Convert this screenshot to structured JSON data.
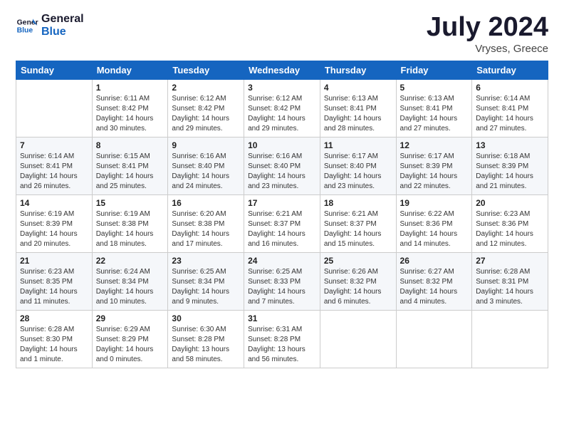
{
  "logo": {
    "line1": "General",
    "line2": "Blue"
  },
  "title": "July 2024",
  "subtitle": "Vryses, Greece",
  "days_of_week": [
    "Sunday",
    "Monday",
    "Tuesday",
    "Wednesday",
    "Thursday",
    "Friday",
    "Saturday"
  ],
  "weeks": [
    [
      {
        "day": "",
        "content": ""
      },
      {
        "day": "1",
        "content": "Sunrise: 6:11 AM\nSunset: 8:42 PM\nDaylight: 14 hours\nand 30 minutes."
      },
      {
        "day": "2",
        "content": "Sunrise: 6:12 AM\nSunset: 8:42 PM\nDaylight: 14 hours\nand 29 minutes."
      },
      {
        "day": "3",
        "content": "Sunrise: 6:12 AM\nSunset: 8:42 PM\nDaylight: 14 hours\nand 29 minutes."
      },
      {
        "day": "4",
        "content": "Sunrise: 6:13 AM\nSunset: 8:41 PM\nDaylight: 14 hours\nand 28 minutes."
      },
      {
        "day": "5",
        "content": "Sunrise: 6:13 AM\nSunset: 8:41 PM\nDaylight: 14 hours\nand 27 minutes."
      },
      {
        "day": "6",
        "content": "Sunrise: 6:14 AM\nSunset: 8:41 PM\nDaylight: 14 hours\nand 27 minutes."
      }
    ],
    [
      {
        "day": "7",
        "content": "Sunrise: 6:14 AM\nSunset: 8:41 PM\nDaylight: 14 hours\nand 26 minutes."
      },
      {
        "day": "8",
        "content": "Sunrise: 6:15 AM\nSunset: 8:41 PM\nDaylight: 14 hours\nand 25 minutes."
      },
      {
        "day": "9",
        "content": "Sunrise: 6:16 AM\nSunset: 8:40 PM\nDaylight: 14 hours\nand 24 minutes."
      },
      {
        "day": "10",
        "content": "Sunrise: 6:16 AM\nSunset: 8:40 PM\nDaylight: 14 hours\nand 23 minutes."
      },
      {
        "day": "11",
        "content": "Sunrise: 6:17 AM\nSunset: 8:40 PM\nDaylight: 14 hours\nand 23 minutes."
      },
      {
        "day": "12",
        "content": "Sunrise: 6:17 AM\nSunset: 8:39 PM\nDaylight: 14 hours\nand 22 minutes."
      },
      {
        "day": "13",
        "content": "Sunrise: 6:18 AM\nSunset: 8:39 PM\nDaylight: 14 hours\nand 21 minutes."
      }
    ],
    [
      {
        "day": "14",
        "content": "Sunrise: 6:19 AM\nSunset: 8:39 PM\nDaylight: 14 hours\nand 20 minutes."
      },
      {
        "day": "15",
        "content": "Sunrise: 6:19 AM\nSunset: 8:38 PM\nDaylight: 14 hours\nand 18 minutes."
      },
      {
        "day": "16",
        "content": "Sunrise: 6:20 AM\nSunset: 8:38 PM\nDaylight: 14 hours\nand 17 minutes."
      },
      {
        "day": "17",
        "content": "Sunrise: 6:21 AM\nSunset: 8:37 PM\nDaylight: 14 hours\nand 16 minutes."
      },
      {
        "day": "18",
        "content": "Sunrise: 6:21 AM\nSunset: 8:37 PM\nDaylight: 14 hours\nand 15 minutes."
      },
      {
        "day": "19",
        "content": "Sunrise: 6:22 AM\nSunset: 8:36 PM\nDaylight: 14 hours\nand 14 minutes."
      },
      {
        "day": "20",
        "content": "Sunrise: 6:23 AM\nSunset: 8:36 PM\nDaylight: 14 hours\nand 12 minutes."
      }
    ],
    [
      {
        "day": "21",
        "content": "Sunrise: 6:23 AM\nSunset: 8:35 PM\nDaylight: 14 hours\nand 11 minutes."
      },
      {
        "day": "22",
        "content": "Sunrise: 6:24 AM\nSunset: 8:34 PM\nDaylight: 14 hours\nand 10 minutes."
      },
      {
        "day": "23",
        "content": "Sunrise: 6:25 AM\nSunset: 8:34 PM\nDaylight: 14 hours\nand 9 minutes."
      },
      {
        "day": "24",
        "content": "Sunrise: 6:25 AM\nSunset: 8:33 PM\nDaylight: 14 hours\nand 7 minutes."
      },
      {
        "day": "25",
        "content": "Sunrise: 6:26 AM\nSunset: 8:32 PM\nDaylight: 14 hours\nand 6 minutes."
      },
      {
        "day": "26",
        "content": "Sunrise: 6:27 AM\nSunset: 8:32 PM\nDaylight: 14 hours\nand 4 minutes."
      },
      {
        "day": "27",
        "content": "Sunrise: 6:28 AM\nSunset: 8:31 PM\nDaylight: 14 hours\nand 3 minutes."
      }
    ],
    [
      {
        "day": "28",
        "content": "Sunrise: 6:28 AM\nSunset: 8:30 PM\nDaylight: 14 hours\nand 1 minute."
      },
      {
        "day": "29",
        "content": "Sunrise: 6:29 AM\nSunset: 8:29 PM\nDaylight: 14 hours\nand 0 minutes."
      },
      {
        "day": "30",
        "content": "Sunrise: 6:30 AM\nSunset: 8:28 PM\nDaylight: 13 hours\nand 58 minutes."
      },
      {
        "day": "31",
        "content": "Sunrise: 6:31 AM\nSunset: 8:28 PM\nDaylight: 13 hours\nand 56 minutes."
      },
      {
        "day": "",
        "content": ""
      },
      {
        "day": "",
        "content": ""
      },
      {
        "day": "",
        "content": ""
      }
    ]
  ]
}
